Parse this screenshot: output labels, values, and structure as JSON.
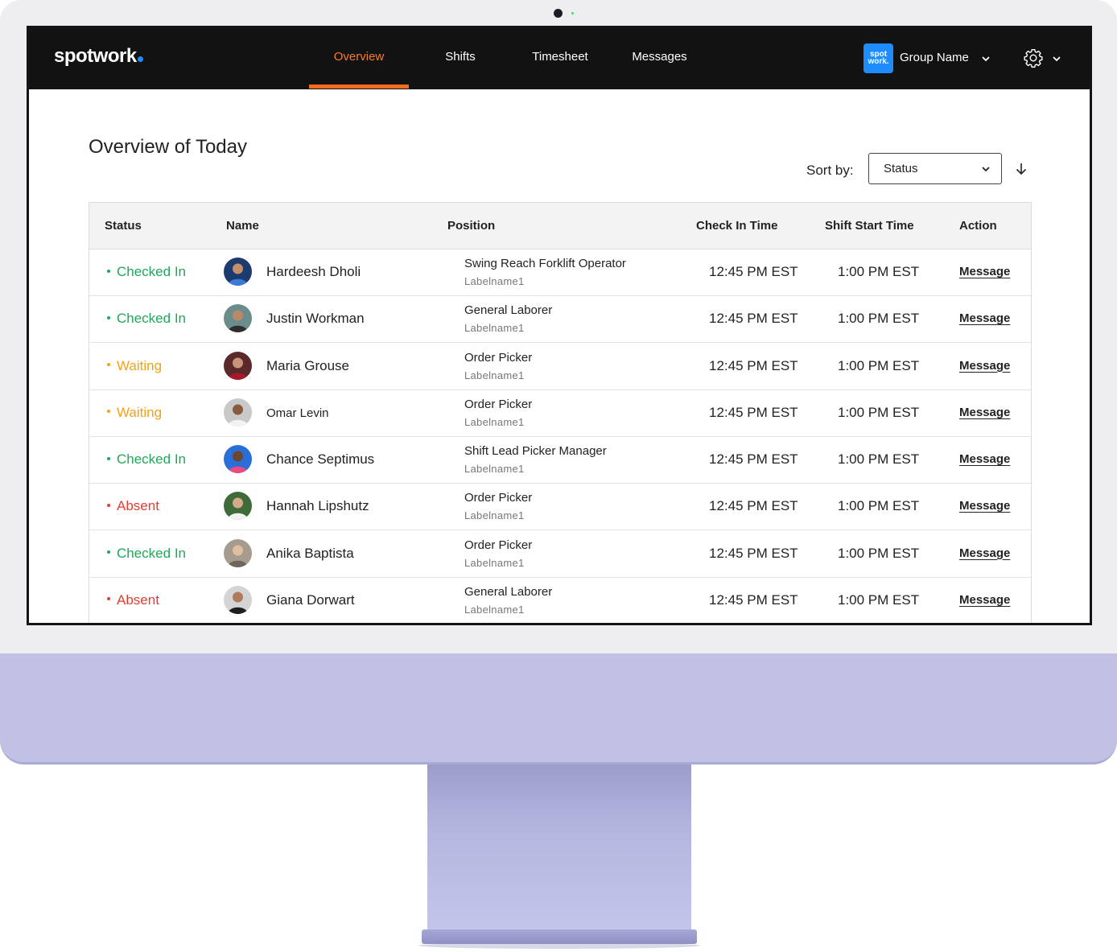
{
  "app": {
    "logo": "spotwork"
  },
  "nav": {
    "items": [
      {
        "label": "Overview",
        "active": true
      },
      {
        "label": "Shifts",
        "active": false
      },
      {
        "label": "Timesheet",
        "active": false
      },
      {
        "label": "Messages",
        "active": false
      }
    ],
    "group_badge_top": "spot",
    "group_badge_bottom": "work.",
    "group_name": "Group Name",
    "accent_color": "#f26d21"
  },
  "page": {
    "title": "Overview of Today",
    "sort_label": "Sort by:",
    "sort_value": "Status",
    "sort_direction_icon": "arrow-down-icon"
  },
  "table": {
    "headers": [
      "Status",
      "Name",
      "Position",
      "Check In Time",
      "Shift Start Time",
      "Action"
    ],
    "status_colors": {
      "Checked In": "#22a65a",
      "Waiting": "#f5a213",
      "Absent": "#e43d30"
    },
    "rows": [
      {
        "status": "Checked In",
        "name": "Hardeesh Dholi",
        "position": "Swing Reach Forklift Operator",
        "label": "Labelname1",
        "check_in": "12:45 PM EST",
        "shift_start": "1:00 PM EST",
        "action": "Message"
      },
      {
        "status": "Checked In",
        "name": "Justin Workman",
        "position": "General Laborer",
        "label": "Labelname1",
        "check_in": "12:45 PM EST",
        "shift_start": "1:00 PM EST",
        "action": "Message"
      },
      {
        "status": "Waiting",
        "name": "Maria Grouse",
        "position": "Order Picker",
        "label": "Labelname1",
        "check_in": "12:45 PM EST",
        "shift_start": "1:00 PM EST",
        "action": "Message"
      },
      {
        "status": "Waiting",
        "name": "Omar Levin",
        "position": "Order Picker",
        "label": "Labelname1",
        "check_in": "12:45 PM EST",
        "shift_start": "1:00 PM EST",
        "action": "Message"
      },
      {
        "status": "Checked In",
        "name": "Chance Septimus",
        "position": "Shift Lead Picker Manager",
        "label": "Labelname1",
        "check_in": "12:45 PM EST",
        "shift_start": "1:00 PM EST",
        "action": "Message"
      },
      {
        "status": "Absent",
        "name": "Hannah Lipshutz",
        "position": "Order Picker",
        "label": "Labelname1",
        "check_in": "12:45 PM EST",
        "shift_start": "1:00 PM EST",
        "action": "Message"
      },
      {
        "status": "Checked In",
        "name": "Anika Baptista",
        "position": "Order Picker",
        "label": "Labelname1",
        "check_in": "12:45 PM EST",
        "shift_start": "1:00 PM EST",
        "action": "Message"
      },
      {
        "status": "Absent",
        "name": "Giana Dorwart",
        "position": "General Laborer",
        "label": "Labelname1",
        "check_in": "12:45 PM EST",
        "shift_start": "1:00 PM EST",
        "action": "Message"
      }
    ]
  }
}
